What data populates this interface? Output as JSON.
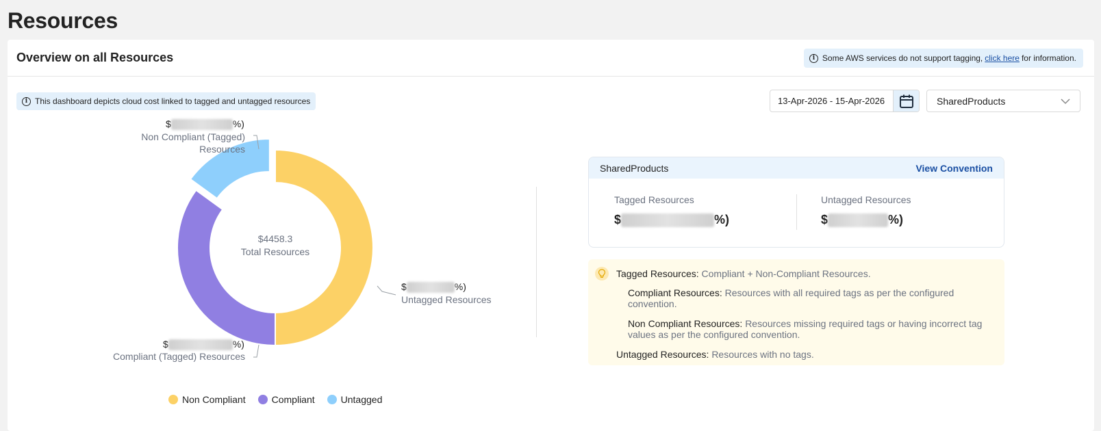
{
  "page": {
    "title": "Resources"
  },
  "overview": {
    "title": "Overview on all Resources",
    "aws_note": {
      "prefix": "Some AWS services do not support tagging,",
      "link": "click here",
      "suffix": "for information."
    },
    "dashboard_note": "This dashboard depicts cloud cost linked to tagged and untagged resources"
  },
  "filters": {
    "date_range": "13-Apr-2026 - 15-Apr-2026",
    "product": "SharedProducts"
  },
  "chart_data": {
    "type": "pie",
    "center_value": "$4458.3",
    "center_label": "Total Resources",
    "slices": [
      {
        "name": "Non Compliant (Tagged) Resources",
        "fraction": 0.5,
        "color": "#fcd166"
      },
      {
        "name": "Compliant (Tagged) Resources",
        "fraction": 0.35,
        "color": "#907fe2"
      },
      {
        "name": "Untagged Resources",
        "fraction": 0.15,
        "color": "#8ecffc"
      }
    ],
    "value_prefix": "$",
    "value_suffix": "%)",
    "legend": [
      {
        "label": "Non Compliant",
        "color": "#fcd166"
      },
      {
        "label": "Compliant",
        "color": "#907fe2"
      },
      {
        "label": "Untagged",
        "color": "#8ecffc"
      }
    ]
  },
  "summary": {
    "product_name": "SharedProducts",
    "view_convention": "View Convention",
    "tagged_label": "Tagged Resources",
    "untagged_label": "Untagged Resources",
    "amount_prefix": "$",
    "amount_suffix": "%)"
  },
  "definitions": {
    "tagged_title": "Tagged Resources:",
    "tagged_desc": "Compliant + Non-Compliant Resources.",
    "compliant_title": "Compliant Resources:",
    "compliant_desc_1": "Resources with all required tags as per the configured",
    "compliant_desc_2": "convention.",
    "noncompliant_title": "Non Compliant Resources:",
    "noncompliant_desc_1": "Resources missing required tags or having incorrect tag",
    "noncompliant_desc_2": "values as per the configured convention.",
    "untagged_title": "Untagged Resources:",
    "untagged_desc": "Resources with no tags."
  }
}
